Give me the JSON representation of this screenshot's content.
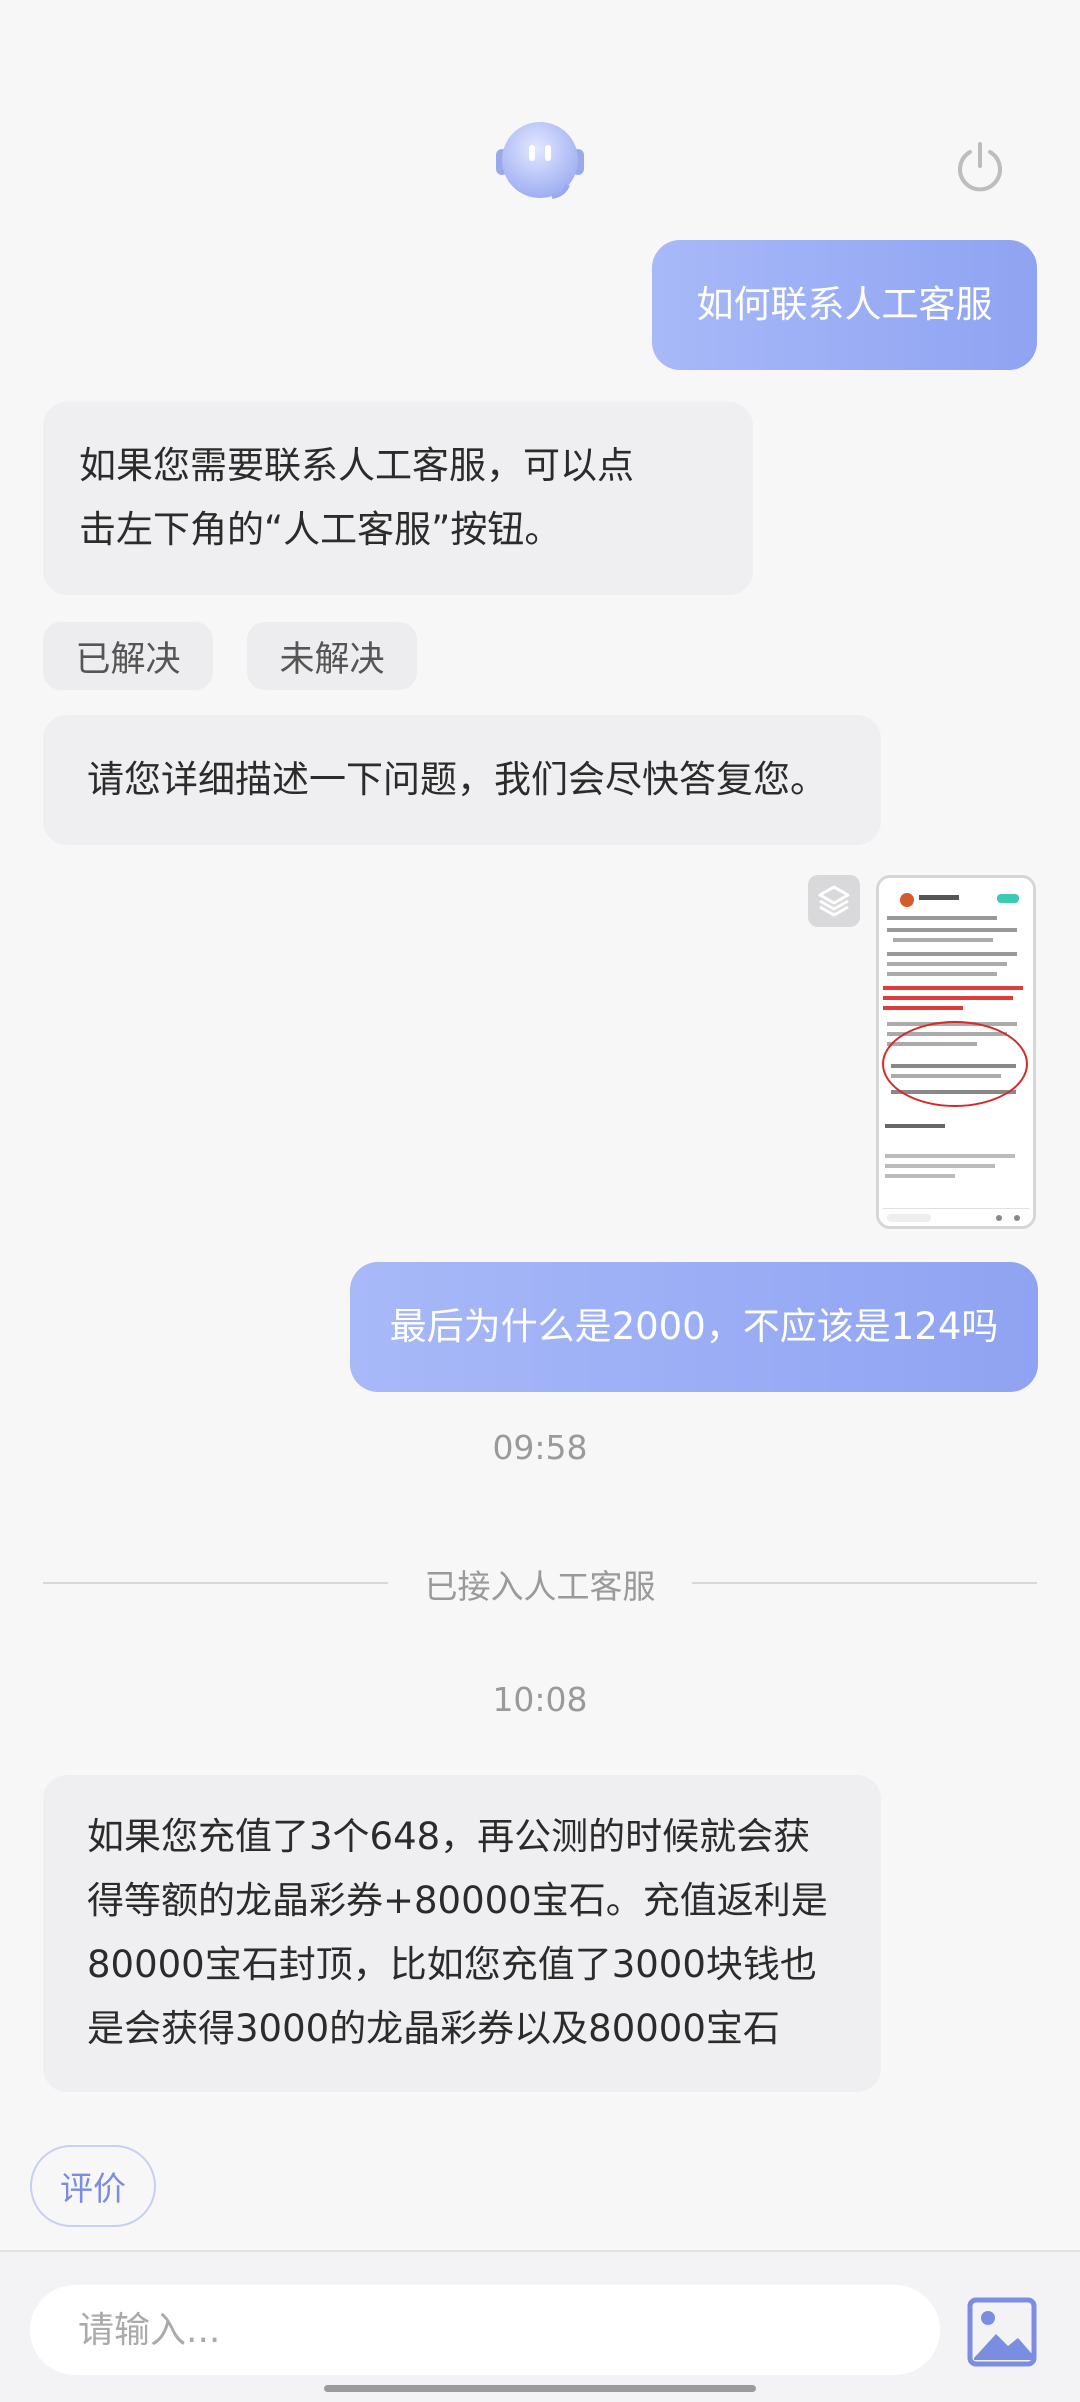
{
  "header": {
    "bot_avatar_icon": "robot-avatar-icon",
    "power_icon": "power-icon"
  },
  "messages": [
    {
      "role": "user",
      "text": "如何联系人工客服"
    },
    {
      "role": "bot",
      "line1": "如果您需要联系人工客服，可以点",
      "line2": "击左下角的“人工客服”按钮。"
    },
    {
      "role": "bot",
      "text": "请您详细描述一下问题，我们会尽快答复您。"
    },
    {
      "role": "user",
      "text": "最后为什么是2000，不应该是124吗"
    },
    {
      "role": "agent",
      "line1": "如果您充值了3个648，再公测的时候就会获",
      "line2": "得等额的龙晶彩券+80000宝石。充值返利是",
      "line3": "80000宝石封顶，比如您充值了3000块钱也",
      "line4": "是会获得3000的龙晶彩券以及80000宝石"
    }
  ],
  "feedback": {
    "solved": "已解决",
    "unsolved": "未解决"
  },
  "time1": "09:58",
  "divider": "已接入人工客服",
  "time2": "10:08",
  "rate_button": "评价",
  "input": {
    "placeholder": "请输入..."
  },
  "colors": {
    "user_bubble_start": "#a8b9f8",
    "user_bubble_end": "#8fa3f2",
    "accent": "#7b8de0"
  }
}
